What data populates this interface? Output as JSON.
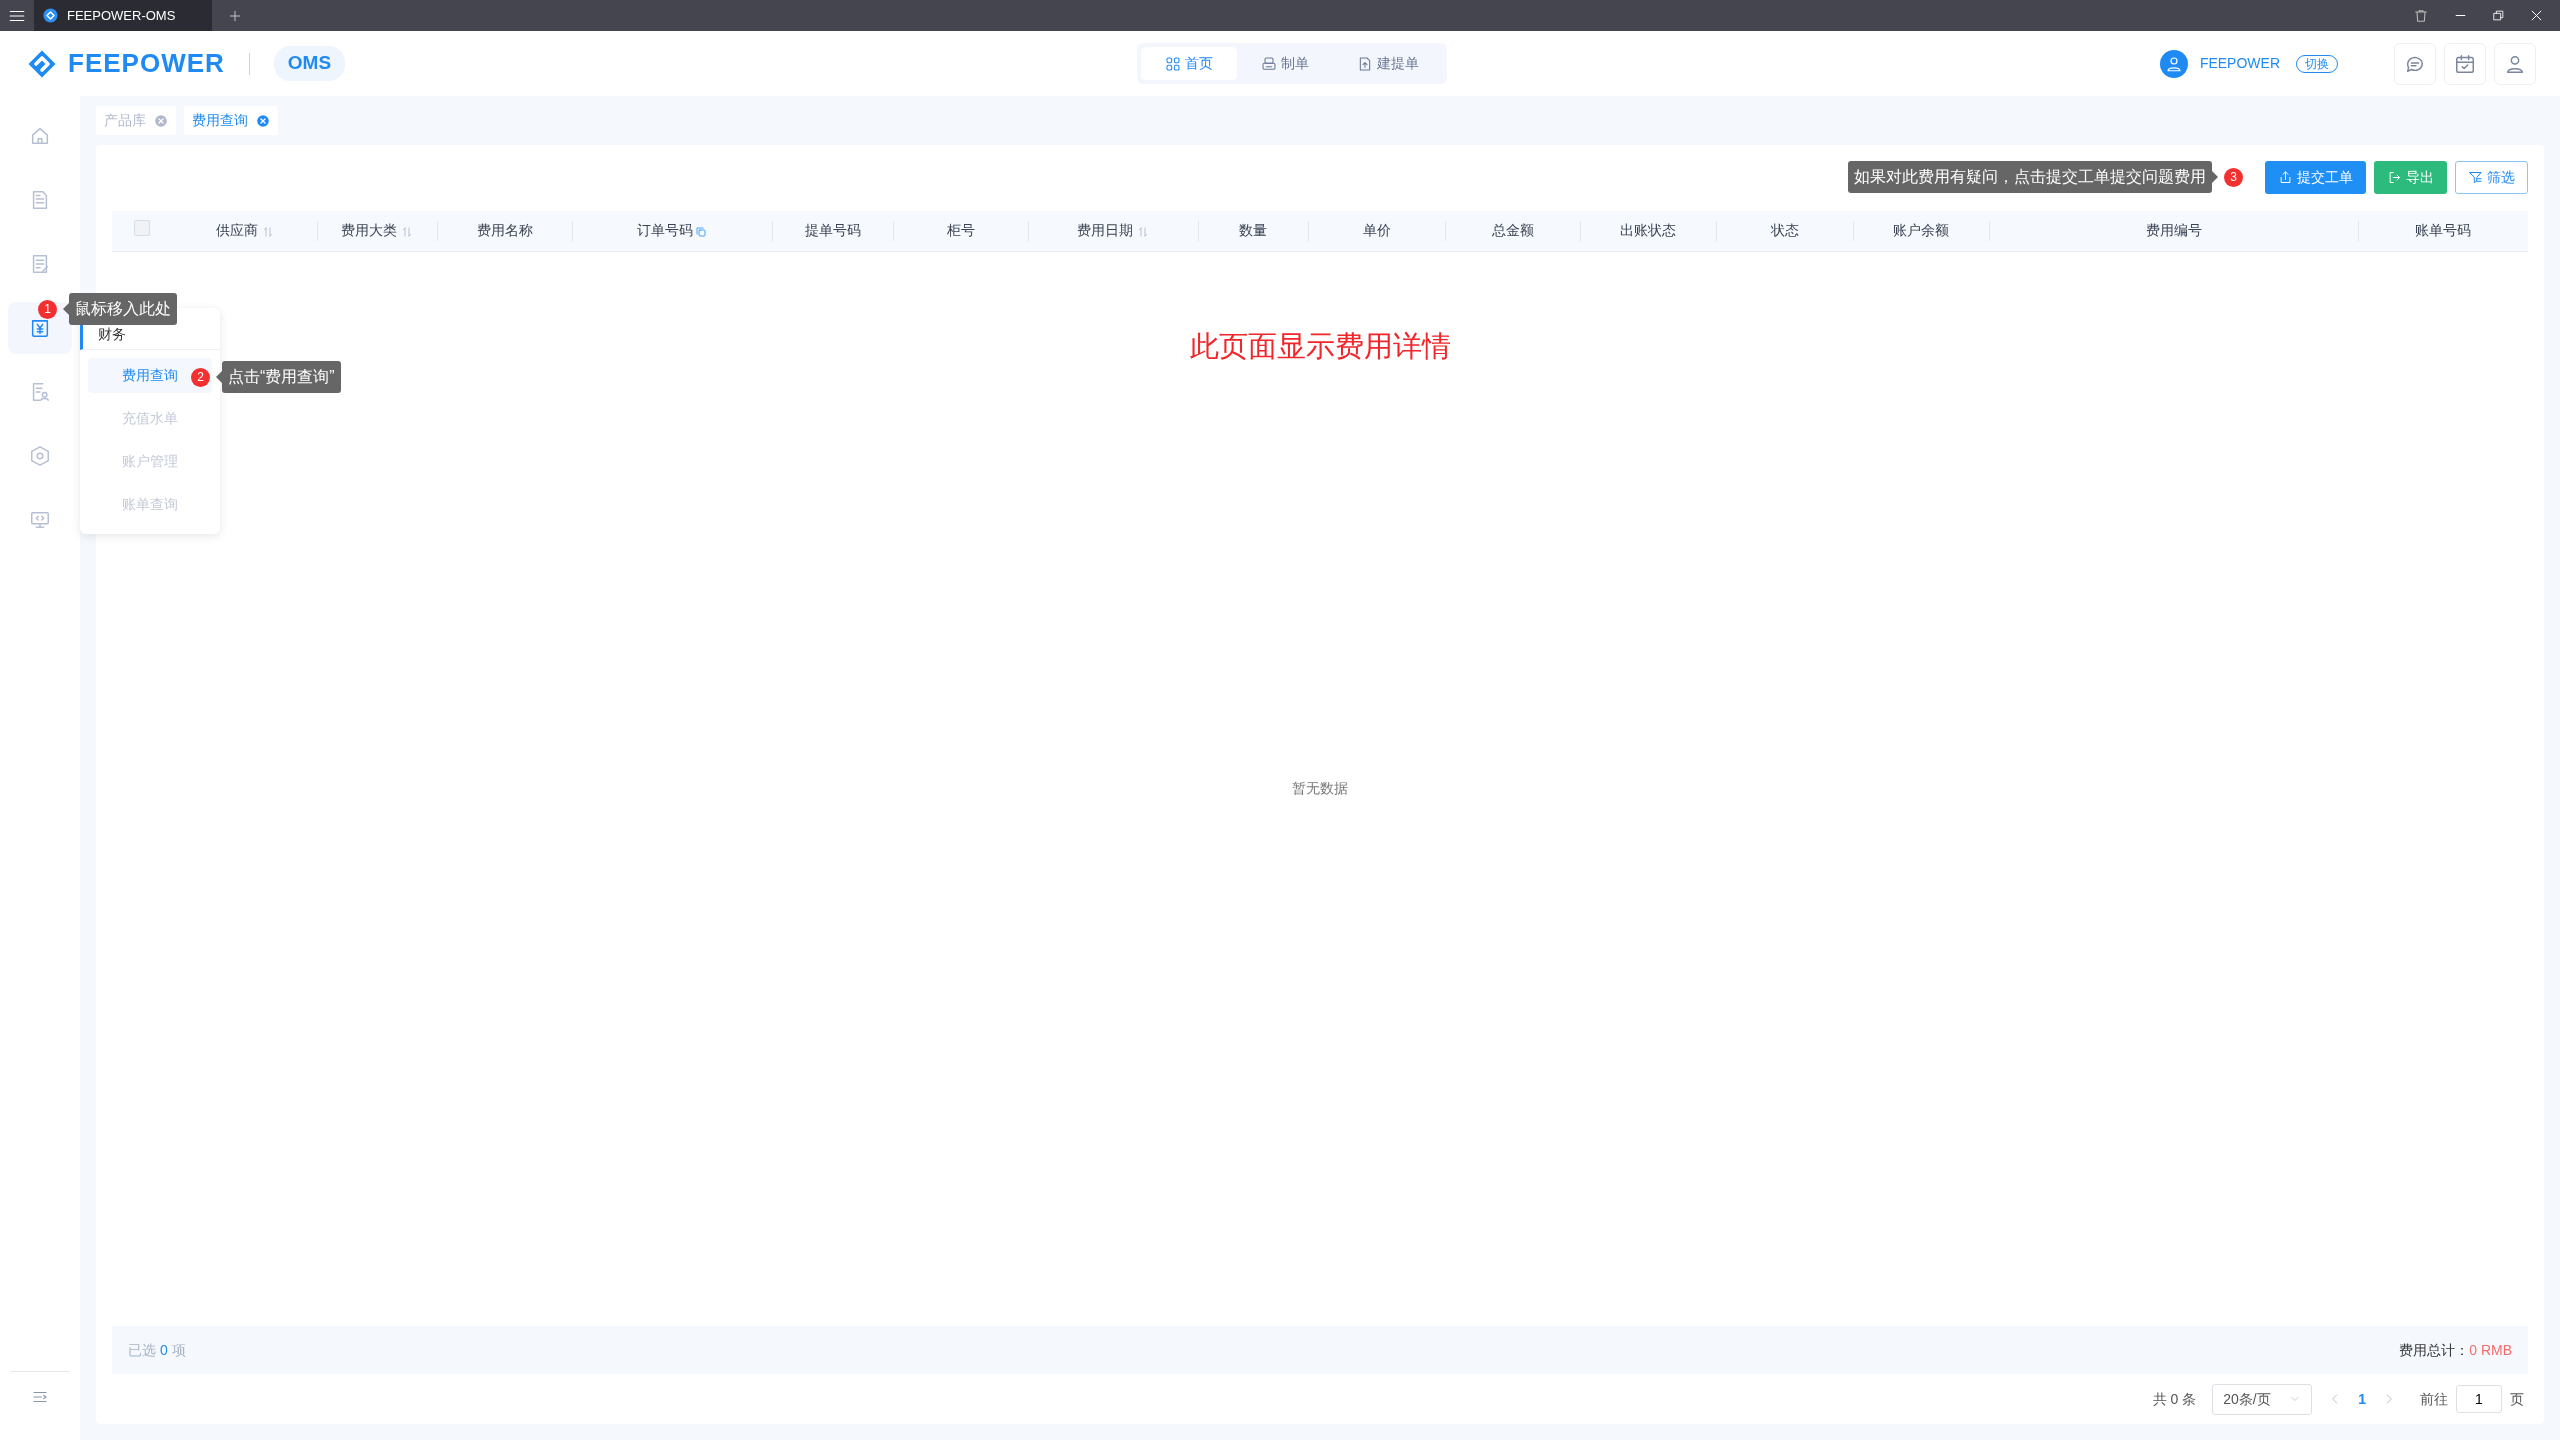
{
  "title_bar": {
    "tab_title": "FEEPOWER-OMS"
  },
  "header": {
    "brand": "FEEPOWER",
    "app": "OMS",
    "nav": [
      {
        "label": "首页",
        "kind": "grid",
        "selected": true
      },
      {
        "label": "制单",
        "kind": "printer",
        "selected": false
      },
      {
        "label": "建提单",
        "kind": "upload",
        "selected": false
      }
    ],
    "user": {
      "name": "FEEPOWER",
      "switch_label": "切换"
    }
  },
  "sidebar": {
    "items": [
      {
        "kind": "home",
        "selected": false
      },
      {
        "kind": "document",
        "selected": false
      },
      {
        "kind": "edit",
        "selected": false
      },
      {
        "kind": "finance",
        "selected": true
      },
      {
        "kind": "report",
        "selected": false
      },
      {
        "kind": "settings",
        "selected": false
      },
      {
        "kind": "monitor",
        "selected": false
      }
    ]
  },
  "flyout_menu": {
    "title": "财务",
    "items": [
      {
        "label": "费用查询",
        "selected": true
      },
      {
        "label": "充值水单",
        "selected": false
      },
      {
        "label": "账户管理",
        "selected": false
      },
      {
        "label": "账单查询",
        "selected": false
      }
    ]
  },
  "page_tabs": [
    {
      "label": "产品库",
      "selected": false
    },
    {
      "label": "费用查询",
      "selected": true
    }
  ],
  "toolbar": {
    "buttons": [
      {
        "label": "提交工单",
        "kind": "primary"
      },
      {
        "label": "导出",
        "kind": "success"
      },
      {
        "label": "筛选",
        "kind": "outline"
      }
    ]
  },
  "annotations": [
    {
      "number": "1",
      "text": "鼠标移入此处"
    },
    {
      "number": "2",
      "text": "点击“费用查询”"
    },
    {
      "number": "3",
      "text": "如果对此费用有疑问，点击提交工单提交问题费用"
    }
  ],
  "table": {
    "select_all": {
      "checked": false
    },
    "columns": [
      {
        "label": "供应商",
        "kind": "sort"
      },
      {
        "label": "费用大类",
        "kind": "sort"
      },
      {
        "label": "费用名称",
        "kind": "plain"
      },
      {
        "label": "订单号码",
        "kind": "copy"
      },
      {
        "label": "提单号码",
        "kind": "plain"
      },
      {
        "label": "柜号",
        "kind": "plain"
      },
      {
        "label": "费用日期",
        "kind": "sort"
      },
      {
        "label": "数量",
        "kind": "plain"
      },
      {
        "label": "单价",
        "kind": "plain"
      },
      {
        "label": "总金额",
        "kind": "plain"
      },
      {
        "label": "出账状态",
        "kind": "plain"
      },
      {
        "label": "状态",
        "kind": "plain"
      },
      {
        "label": "账户余额",
        "kind": "plain"
      },
      {
        "label": "费用编号",
        "kind": "plain"
      },
      {
        "label": "账单号码",
        "kind": "plain"
      }
    ],
    "notice": "此页面显示费用详情",
    "empty_text": "暂无数据"
  },
  "summary": {
    "selected_label": "已选",
    "selected_count": "0",
    "selected_unit": "项",
    "total_label": "费用总计：",
    "total_value": "0 RMB"
  },
  "pagination": {
    "total": "共 0 条",
    "page_size": "20条/页",
    "pages": [
      {
        "label": "1",
        "selected": true
      }
    ],
    "goto_label": "前往",
    "goto_value": "1",
    "page_unit": "页"
  }
}
